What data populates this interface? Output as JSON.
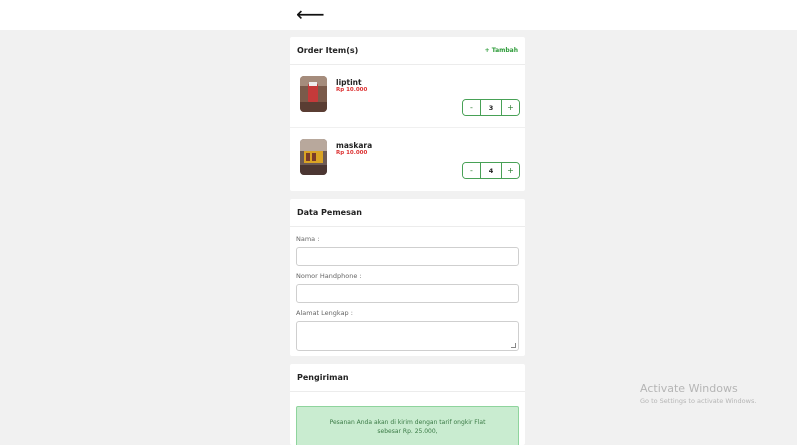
{
  "nav": {
    "back_arrow": "⟵"
  },
  "order": {
    "title": "Order Item(s)",
    "add_label": "+ Tambah",
    "items": [
      {
        "name": "liptint",
        "price": "Rp 10.000",
        "qty": "3",
        "minus": "-",
        "plus": "+"
      },
      {
        "name": "maskara",
        "price": "Rp 10.000",
        "qty": "4",
        "minus": "-",
        "plus": "+"
      }
    ]
  },
  "customer": {
    "title": "Data Pemesan",
    "name_label": "Nama :",
    "phone_label": "Nomor Handphone :",
    "address_label": "Alamat Lengkap :",
    "name_value": "",
    "phone_value": "",
    "address_value": ""
  },
  "shipping": {
    "title": "Pengiriman",
    "notice": "Pesanan Anda akan di kirim dengan tarif ongkir Flat sebesar Rp. 25.000,"
  },
  "windows_watermark": {
    "line1": "Activate Windows",
    "line2": "Go to Settings to activate Windows."
  },
  "colors": {
    "accent": "#2e9c3a",
    "price": "#d33333",
    "notice_bg": "#c9ecd0"
  }
}
